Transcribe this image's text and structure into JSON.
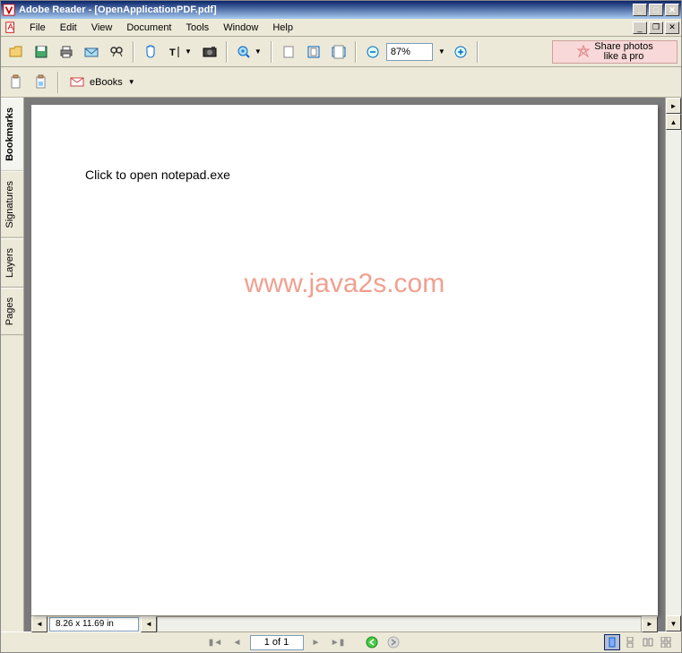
{
  "window": {
    "title": "Adobe Reader - [OpenApplicationPDF.pdf]"
  },
  "menu": {
    "file": "File",
    "edit": "Edit",
    "view": "View",
    "document": "Document",
    "tools": "Tools",
    "window": "Window",
    "help": "Help"
  },
  "toolbar": {
    "zoom_value": "87%",
    "ebooks_label": "eBooks"
  },
  "promo": {
    "line1": "Share photos",
    "line2": "like a pro"
  },
  "sidebar": {
    "bookmarks": "Bookmarks",
    "signatures": "Signatures",
    "layers": "Layers",
    "pages": "Pages"
  },
  "document": {
    "link_text": "Click to open notepad.exe",
    "watermark": "www.java2s.com",
    "dimensions": "8.26 x 11.69 in"
  },
  "status": {
    "page_indicator": "1 of 1"
  }
}
